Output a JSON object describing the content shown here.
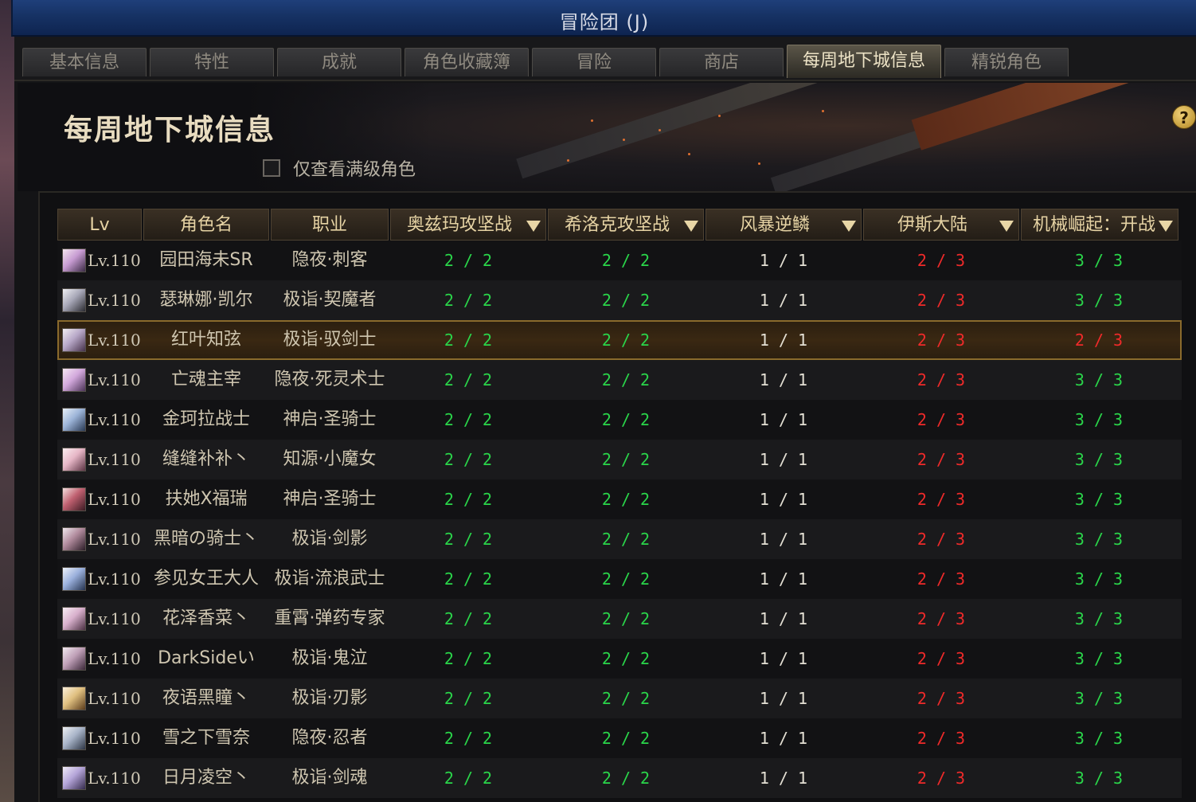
{
  "window": {
    "title": "冒险团 (J)"
  },
  "tabs": [
    {
      "label": "基本信息",
      "active": false
    },
    {
      "label": "特性",
      "active": false
    },
    {
      "label": "成就",
      "active": false
    },
    {
      "label": "角色收藏簿",
      "active": false
    },
    {
      "label": "冒险",
      "active": false
    },
    {
      "label": "商店",
      "active": false
    },
    {
      "label": "每周地下城信息",
      "active": true
    },
    {
      "label": "精锐角色",
      "active": false
    }
  ],
  "page": {
    "title": "每周地下城信息",
    "filter_label": "仅查看满级角色",
    "filter_checked": false,
    "help": "?"
  },
  "columns": {
    "lv": "Lv",
    "name": "角色名",
    "job": "职业",
    "d1": "奥兹玛攻坚战",
    "d2": "希洛克攻坚战",
    "d3": "风暴逆鳞",
    "d4": "伊斯大陆",
    "d5": "机械崛起：开战"
  },
  "colors": {
    "complete": "#2ad64a",
    "neutral": "#e4e0d4",
    "incomplete": "#f02a2a",
    "selected_border": "#8a6a2c"
  },
  "rows": [
    {
      "lv": "Lv.110",
      "name": "园田海未SR",
      "job": "隐夜·刺客",
      "d1": "2 / 2",
      "d2": "2 / 2",
      "d3": "1 / 1",
      "d4": "2 / 3",
      "d5": "3 / 3",
      "d5_status": "complete",
      "selected": false
    },
    {
      "lv": "Lv.110",
      "name": "瑟琳娜·凯尔",
      "job": "极诣·契魔者",
      "d1": "2 / 2",
      "d2": "2 / 2",
      "d3": "1 / 1",
      "d4": "2 / 3",
      "d5": "3 / 3",
      "d5_status": "complete",
      "selected": false
    },
    {
      "lv": "Lv.110",
      "name": "红叶知弦",
      "job": "极诣·驭剑士",
      "d1": "2 / 2",
      "d2": "2 / 2",
      "d3": "1 / 1",
      "d4": "2 / 3",
      "d5": "2 / 3",
      "d5_status": "incomplete",
      "selected": true
    },
    {
      "lv": "Lv.110",
      "name": "亡魂主宰",
      "job": "隐夜·死灵术士",
      "d1": "2 / 2",
      "d2": "2 / 2",
      "d3": "1 / 1",
      "d4": "2 / 3",
      "d5": "3 / 3",
      "d5_status": "complete",
      "selected": false
    },
    {
      "lv": "Lv.110",
      "name": "金珂拉战士",
      "job": "神启·圣骑士",
      "d1": "2 / 2",
      "d2": "2 / 2",
      "d3": "1 / 1",
      "d4": "2 / 3",
      "d5": "3 / 3",
      "d5_status": "complete",
      "selected": false
    },
    {
      "lv": "Lv.110",
      "name": "缝缝补补丶",
      "job": "知源·小魔女",
      "d1": "2 / 2",
      "d2": "2 / 2",
      "d3": "1 / 1",
      "d4": "2 / 3",
      "d5": "3 / 3",
      "d5_status": "complete",
      "selected": false
    },
    {
      "lv": "Lv.110",
      "name": "扶她X福瑞",
      "job": "神启·圣骑士",
      "d1": "2 / 2",
      "d2": "2 / 2",
      "d3": "1 / 1",
      "d4": "2 / 3",
      "d5": "3 / 3",
      "d5_status": "complete",
      "selected": false
    },
    {
      "lv": "Lv.110",
      "name": "黑暗の骑士丶",
      "job": "极诣·剑影",
      "d1": "2 / 2",
      "d2": "2 / 2",
      "d3": "1 / 1",
      "d4": "2 / 3",
      "d5": "3 / 3",
      "d5_status": "complete",
      "selected": false
    },
    {
      "lv": "Lv.110",
      "name": "参见女王大人",
      "job": "极诣·流浪武士",
      "d1": "2 / 2",
      "d2": "2 / 2",
      "d3": "1 / 1",
      "d4": "2 / 3",
      "d5": "3 / 3",
      "d5_status": "complete",
      "selected": false
    },
    {
      "lv": "Lv.110",
      "name": "花泽香菜丶",
      "job": "重霄·弹药专家",
      "d1": "2 / 2",
      "d2": "2 / 2",
      "d3": "1 / 1",
      "d4": "2 / 3",
      "d5": "3 / 3",
      "d5_status": "complete",
      "selected": false
    },
    {
      "lv": "Lv.110",
      "name": "DarkSideい",
      "job": "极诣·鬼泣",
      "d1": "2 / 2",
      "d2": "2 / 2",
      "d3": "1 / 1",
      "d4": "2 / 3",
      "d5": "3 / 3",
      "d5_status": "complete",
      "selected": false
    },
    {
      "lv": "Lv.110",
      "name": "夜语黑瞳丶",
      "job": "极诣·刃影",
      "d1": "2 / 2",
      "d2": "2 / 2",
      "d3": "1 / 1",
      "d4": "2 / 3",
      "d5": "3 / 3",
      "d5_status": "complete",
      "selected": false
    },
    {
      "lv": "Lv.110",
      "name": "雪之下雪奈",
      "job": "隐夜·忍者",
      "d1": "2 / 2",
      "d2": "2 / 2",
      "d3": "1 / 1",
      "d4": "2 / 3",
      "d5": "3 / 3",
      "d5_status": "complete",
      "selected": false
    },
    {
      "lv": "Lv.110",
      "name": "日月凌空丶",
      "job": "极诣·剑魂",
      "d1": "2 / 2",
      "d2": "2 / 2",
      "d3": "1 / 1",
      "d4": "2 / 3",
      "d5": "3 / 3",
      "d5_status": "complete",
      "selected": false
    }
  ]
}
